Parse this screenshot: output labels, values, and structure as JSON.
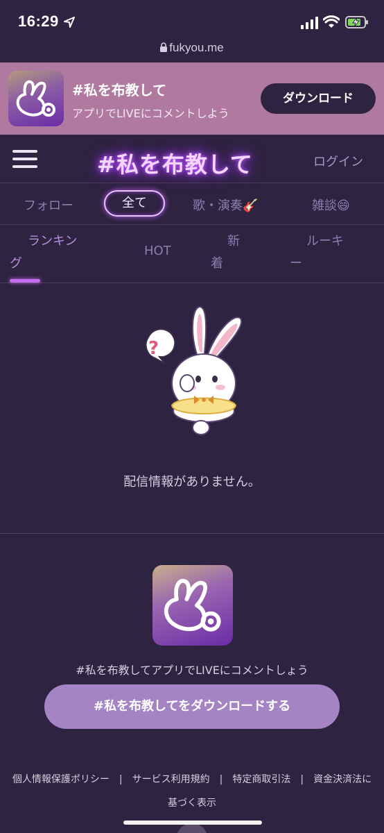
{
  "status_bar": {
    "time": "16:29",
    "url": "fukyou.me"
  },
  "banner": {
    "title": "#私を布教して",
    "subtitle": "アプリでLIVEにコメントしよう",
    "download_label": "ダウンロード"
  },
  "header": {
    "logo": "#私を布教して",
    "login_label": "ログイン"
  },
  "category_tabs": [
    {
      "label": "フォロー",
      "active": false
    },
    {
      "label": "全て",
      "active": true
    },
    {
      "label": "歌・演奏🎸",
      "active": false
    },
    {
      "label": "雑談😄",
      "active": false
    }
  ],
  "sub_tabs": [
    {
      "line1": "ランキン",
      "line2": "グ",
      "active": true
    },
    {
      "line1": "HOT",
      "line2": "",
      "active": false
    },
    {
      "line1": "新",
      "line2": "着",
      "active": false
    },
    {
      "line1": "ルーキ",
      "line2": "ー",
      "active": false
    }
  ],
  "empty_state": {
    "message": "配信情報がありません。",
    "bubble_glyph": "?"
  },
  "promo": {
    "text": "#私を布教してアプリでLIVEにコメントしょう",
    "download_button": "#私を布教してをダウンロードする"
  },
  "footer": {
    "links": [
      "個人情報保護ポリシー",
      "サービス利用規約",
      "特定商取引法",
      "資金決済法に基づく表示"
    ],
    "separator": "|"
  },
  "colors": {
    "background": "#2e2340",
    "banner": "#b07aa0",
    "neon": "#c25bff",
    "button": "#a584c4"
  }
}
